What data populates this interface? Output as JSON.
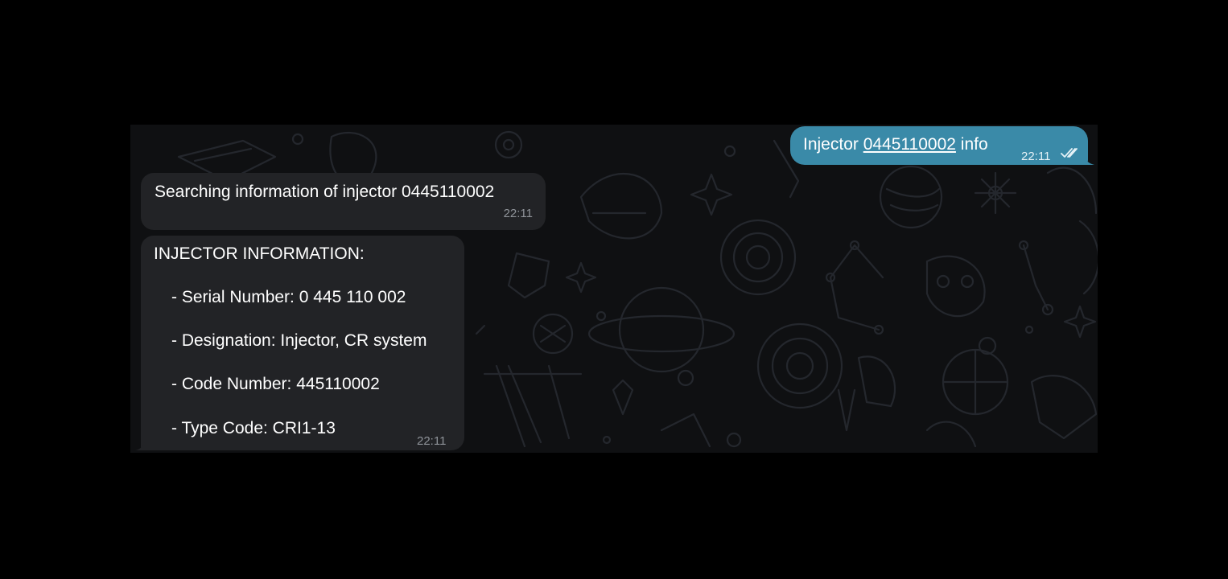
{
  "colors": {
    "background": "#000000",
    "chat_background": "#0f1012",
    "outgoing_bubble": "#3a8aa8",
    "incoming_bubble": "#222326",
    "timestamp": "#8f9399"
  },
  "chat": {
    "wallpaper": "space-doodle-pattern",
    "messages": [
      {
        "direction": "outgoing",
        "prefix": "Injector ",
        "link": "0445110002",
        "suffix": " info",
        "time": "22:11",
        "status_icon": "double-check-icon"
      },
      {
        "direction": "incoming",
        "text": "Searching information of injector 0445110002",
        "time": "22:11"
      },
      {
        "direction": "incoming",
        "title": "INJECTOR INFORMATION:",
        "lines": [
          "- Serial Number: 0 445 110 002",
          "- Designation: Injector, CR system",
          "- Code Number: 445110002",
          "- Type Code: CRI1-13"
        ],
        "time": "22:11"
      }
    ]
  }
}
